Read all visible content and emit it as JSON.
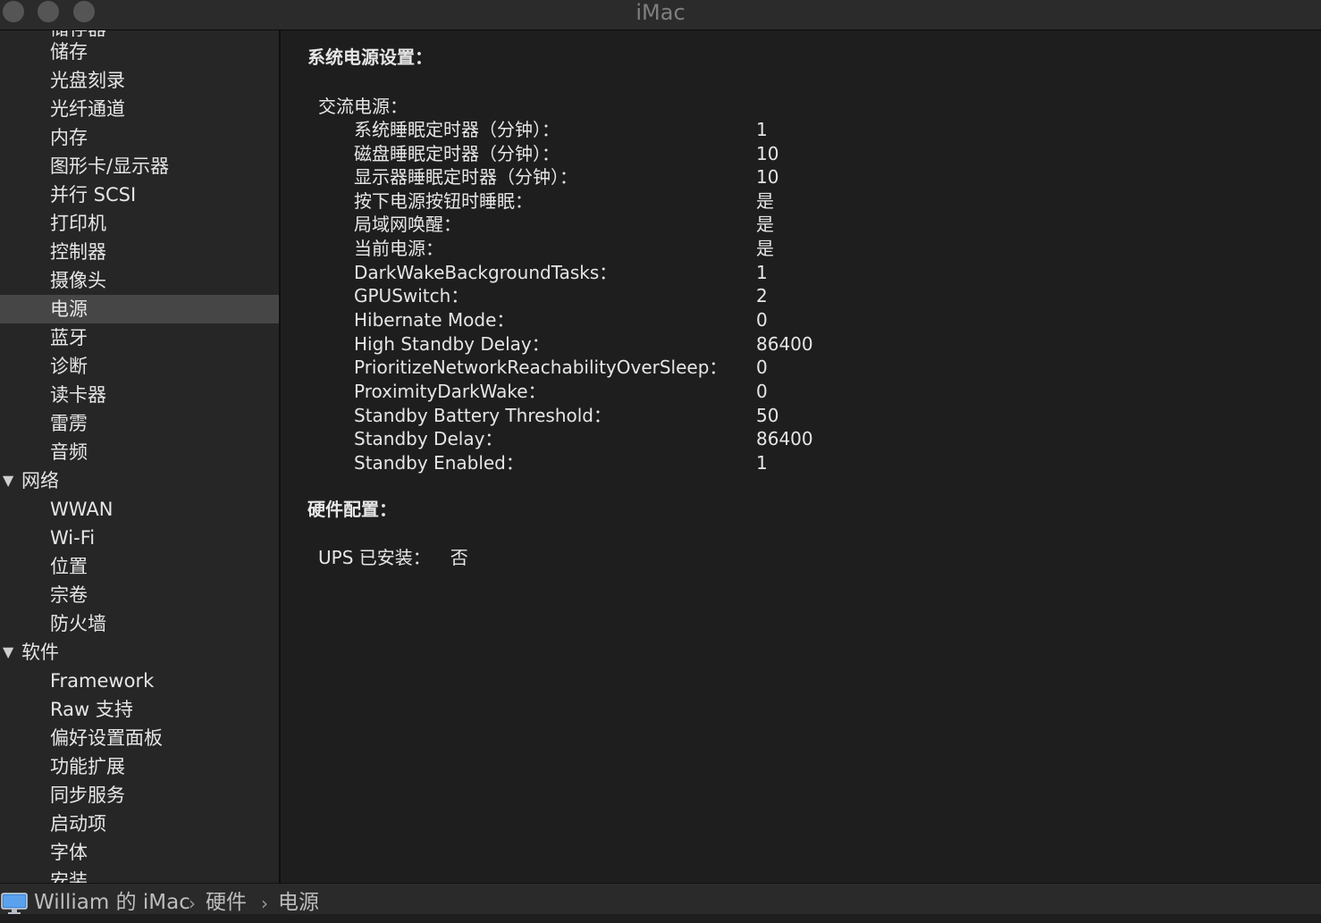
{
  "window": {
    "title": "iMac"
  },
  "sidebar": {
    "top_partial": "储存器",
    "hardware_items": [
      "储存",
      "光盘刻录",
      "光纤通道",
      "内存",
      "图形卡/显示器",
      "并行 SCSI",
      "打印机",
      "控制器",
      "摄像头",
      "电源",
      "蓝牙",
      "诊断",
      "读卡器",
      "雷雳",
      "音频"
    ],
    "network_label": "网络",
    "network_items": [
      "WWAN",
      "Wi-Fi",
      "位置",
      "宗卷",
      "防火墙"
    ],
    "software_label": "软件",
    "software_items": [
      "Framework",
      "Raw 支持",
      "偏好设置面板",
      "功能扩展",
      "同步服务",
      "启动项",
      "字体",
      "安装"
    ],
    "selected": "电源"
  },
  "content": {
    "power_settings_heading": "系统电源设置：",
    "ac_power_label": "交流电源：",
    "ac_rows": [
      {
        "key": "系统睡眠定时器（分钟）：",
        "value": "1"
      },
      {
        "key": "磁盘睡眠定时器（分钟）：",
        "value": "10"
      },
      {
        "key": "显示器睡眠定时器（分钟）：",
        "value": "10"
      },
      {
        "key": "按下电源按钮时睡眠：",
        "value": "是"
      },
      {
        "key": "局域网唤醒：",
        "value": "是"
      },
      {
        "key": "当前电源：",
        "value": "是"
      },
      {
        "key": "DarkWakeBackgroundTasks：",
        "value": "1"
      },
      {
        "key": "GPUSwitch：",
        "value": "2"
      },
      {
        "key": "Hibernate Mode：",
        "value": "0"
      },
      {
        "key": "High Standby Delay：",
        "value": "86400"
      },
      {
        "key": "PrioritizeNetworkReachabilityOverSleep：",
        "value": "0"
      },
      {
        "key": "ProximityDarkWake：",
        "value": "0"
      },
      {
        "key": "Standby Battery Threshold：",
        "value": "50"
      },
      {
        "key": "Standby Delay：",
        "value": "86400"
      },
      {
        "key": "Standby Enabled：",
        "value": "1"
      }
    ],
    "hardware_config_heading": "硬件配置：",
    "ups_label": "UPS 已安装：",
    "ups_value": "否"
  },
  "pathbar": {
    "crumbs": [
      "William 的 iMac",
      "硬件",
      "电源"
    ]
  }
}
